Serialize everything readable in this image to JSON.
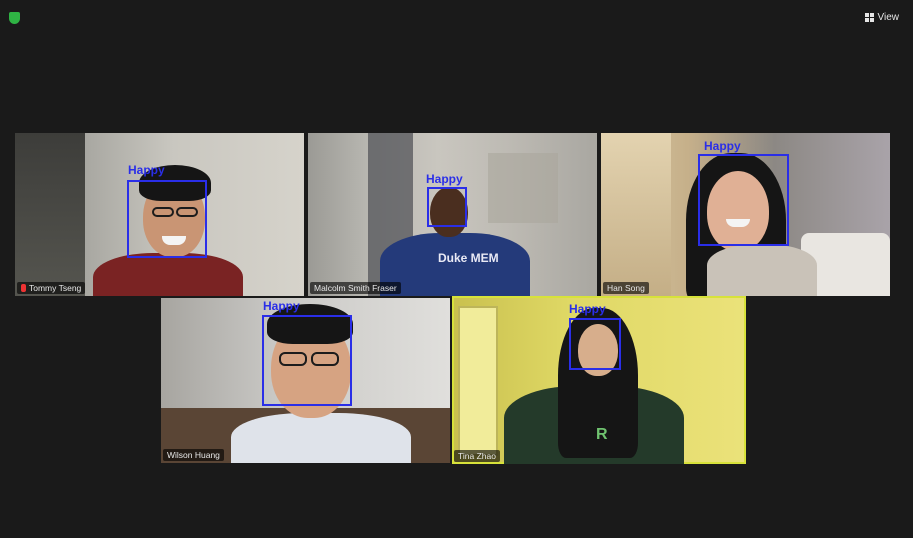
{
  "toolbar": {
    "view_label": "View"
  },
  "participants": [
    {
      "name": "Tommy Tseng",
      "emotion": "Happy",
      "muted": true
    },
    {
      "name": "Malcolm Smith Fraser",
      "emotion": "Happy",
      "muted": false,
      "shirt_text": "Duke MEM"
    },
    {
      "name": "Han Song",
      "emotion": "Happy",
      "muted": false
    },
    {
      "name": "Wilson Huang",
      "emotion": "Happy",
      "muted": false
    },
    {
      "name": "Tina Zhao",
      "emotion": "Happy",
      "muted": false,
      "active_speaker": true,
      "shirt_text": "R"
    }
  ],
  "icons": {
    "security": "shield-icon",
    "view": "grid-view-icon",
    "muted": "mic-muted-icon"
  },
  "colors": {
    "background": "#1a1a1a",
    "face_box": "#2a2ee8",
    "active_speaker_border": "#d7e23a",
    "security_green": "#2fb344"
  }
}
